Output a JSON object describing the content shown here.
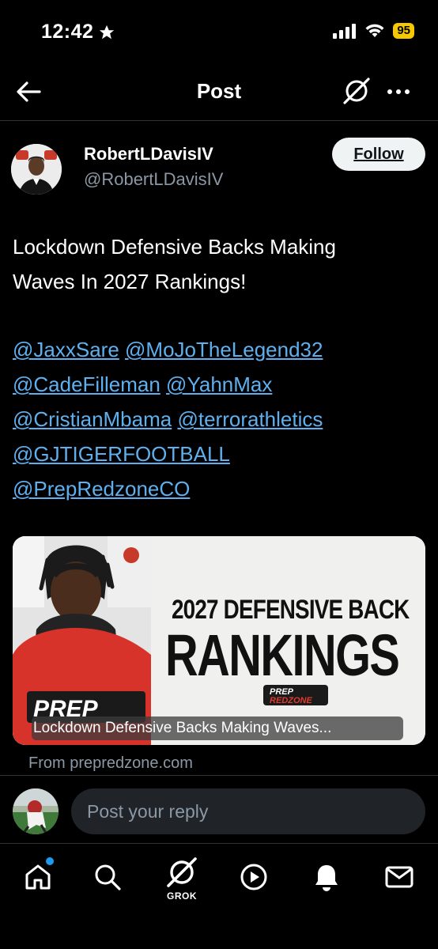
{
  "status_bar": {
    "time": "12:42",
    "battery": "95"
  },
  "nav": {
    "title": "Post"
  },
  "post": {
    "author_name": "RobertLDavisIV",
    "author_handle": "@RobertLDavisIV",
    "follow_label": "Follow",
    "text_line1": "Lockdown Defensive Backs Making",
    "text_line2": "Waves In 2027 Rankings!",
    "mentions": [
      [
        "@JaxxSare",
        "@MoJoTheLegend32"
      ],
      [
        "@CadeFilleman",
        "@YahnMax"
      ],
      [
        "@CristianMbama",
        "@terrorathletics"
      ],
      [
        "@GJTIGERFOOTBALL"
      ],
      [
        "@PrepRedzoneCO"
      ]
    ],
    "card": {
      "headline_small": "2027 DEFENSIVE BACK",
      "headline_big": "RANKINGS",
      "logo_text_top": "PREP",
      "logo_text_bottom": "REDZONE",
      "photo_logo_text": "PREP",
      "title": "Lockdown Defensive Backs Making Waves...",
      "source": "From prepredzone.com"
    }
  },
  "reply": {
    "placeholder": "Post your reply"
  },
  "tabs": {
    "grok_label": "GROK"
  }
}
